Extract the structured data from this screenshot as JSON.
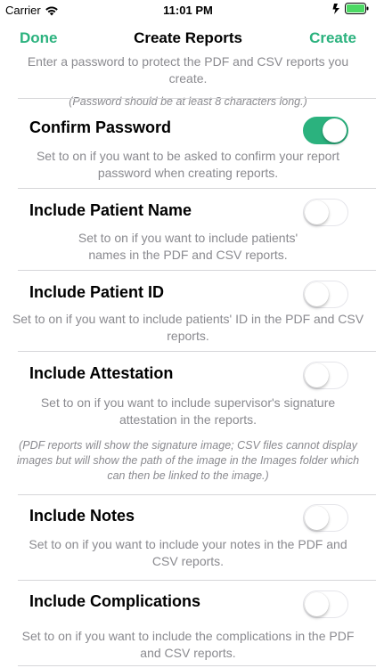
{
  "status": {
    "carrier": "Carrier",
    "time": "11:01 PM"
  },
  "nav": {
    "done": "Done",
    "title": "Create Reports",
    "create": "Create"
  },
  "password": {
    "description": "Enter a password to protect the PDF and CSV reports you create.",
    "note": "(Password should be at least 8 characters long.)"
  },
  "settings": [
    {
      "title": "Confirm Password",
      "description": "Set to on if you want to be asked to confirm your report password when creating reports.",
      "on": true
    },
    {
      "title": "Include Patient Name",
      "description": "Set to on if you want to include patients' names in the PDF and CSV reports.",
      "on": false
    },
    {
      "title": "Include Patient ID",
      "description": "Set to on if you want to include patients' ID in the PDF and CSV reports.",
      "on": false
    },
    {
      "title": "Include Attestation",
      "description": "Set to on if you want to include supervisor's signature attestation in the reports.",
      "note": "(PDF reports will show the signature image; CSV files cannot display images but will show the path of the image in the Images folder which can then be linked to the image.)",
      "on": false
    },
    {
      "title": "Include Notes",
      "description": "Set to on if you want to include your notes in the PDF and CSV reports.",
      "on": false
    },
    {
      "title": "Include Complications",
      "description": "Set to on if you want to include the complications in the PDF and CSV reports.",
      "on": false
    }
  ],
  "colors": {
    "accent": "#2bb27e",
    "secondary_text": "#8a8a8f"
  }
}
